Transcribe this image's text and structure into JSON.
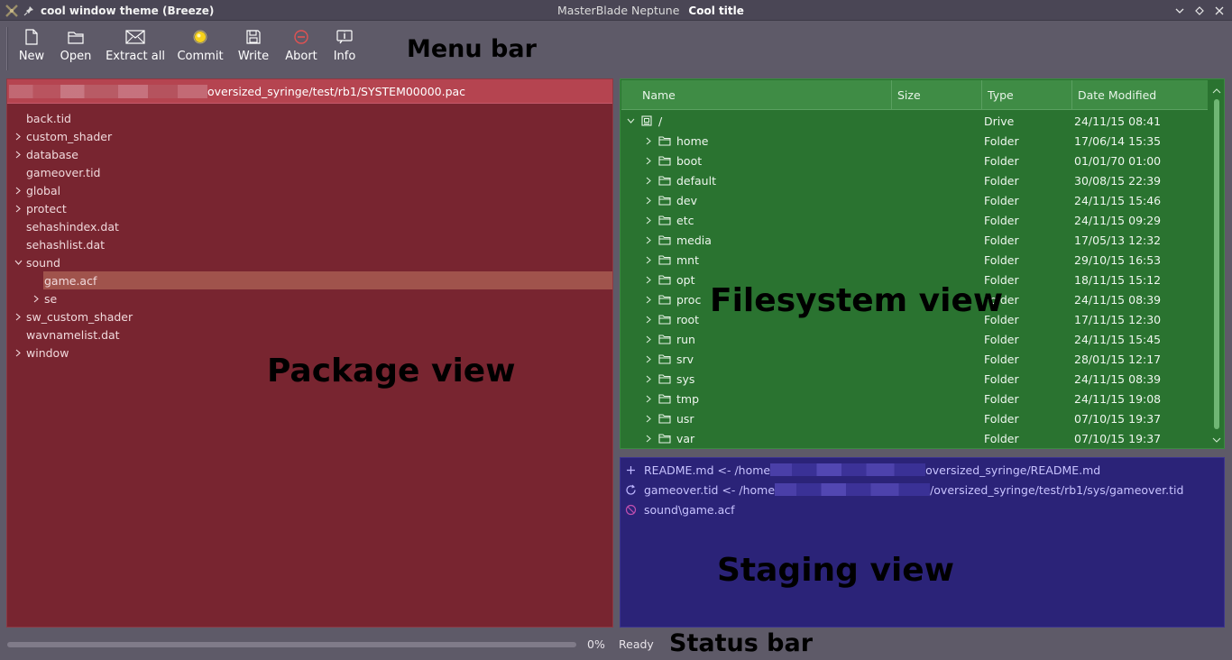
{
  "titlebar": {
    "window_title": "cool window theme (Breeze)",
    "app_name": "MasterBlade Neptune",
    "cool_title": "Cool title"
  },
  "toolbar": {
    "new": "New",
    "open": "Open",
    "extract_all": "Extract all",
    "commit": "Commit",
    "write": "Write",
    "abort": "Abort",
    "info": "Info"
  },
  "annotations": {
    "menu_bar": "Menu bar",
    "package_view": "Package view",
    "filesystem_view": "Filesystem view",
    "staging_view": "Staging view",
    "status_bar": "Status bar"
  },
  "package": {
    "path": "oversized_syringe/test/rb1/SYSTEM00000.pac",
    "items": [
      {
        "label": "back.tid"
      },
      {
        "label": "custom_shader"
      },
      {
        "label": "database"
      },
      {
        "label": "gameover.tid"
      },
      {
        "label": "global"
      },
      {
        "label": "protect"
      },
      {
        "label": "sehashindex.dat"
      },
      {
        "label": "sehashlist.dat"
      },
      {
        "label": "sound"
      },
      {
        "label": "game.acf"
      },
      {
        "label": "se"
      },
      {
        "label": "sw_custom_shader"
      },
      {
        "label": "wavnamelist.dat"
      },
      {
        "label": "window"
      }
    ]
  },
  "filesystem": {
    "columns": {
      "name": "Name",
      "size": "Size",
      "type": "Type",
      "date": "Date Modified"
    },
    "rows": [
      {
        "name": "/",
        "type": "Drive",
        "date": "24/11/15 08:41"
      },
      {
        "name": "home",
        "type": "Folder",
        "date": "17/06/14 15:35"
      },
      {
        "name": "boot",
        "type": "Folder",
        "date": "01/01/70 01:00"
      },
      {
        "name": "default",
        "type": "Folder",
        "date": "30/08/15 22:39"
      },
      {
        "name": "dev",
        "type": "Folder",
        "date": "24/11/15 15:46"
      },
      {
        "name": "etc",
        "type": "Folder",
        "date": "24/11/15 09:29"
      },
      {
        "name": "media",
        "type": "Folder",
        "date": "17/05/13 12:32"
      },
      {
        "name": "mnt",
        "type": "Folder",
        "date": "29/10/15 16:53"
      },
      {
        "name": "opt",
        "type": "Folder",
        "date": "18/11/15 15:12"
      },
      {
        "name": "proc",
        "type": "Folder",
        "date": "24/11/15 08:39"
      },
      {
        "name": "root",
        "type": "Folder",
        "date": "17/11/15 12:30"
      },
      {
        "name": "run",
        "type": "Folder",
        "date": "24/11/15 15:45"
      },
      {
        "name": "srv",
        "type": "Folder",
        "date": "28/01/15 12:17"
      },
      {
        "name": "sys",
        "type": "Folder",
        "date": "24/11/15 08:39"
      },
      {
        "name": "tmp",
        "type": "Folder",
        "date": "24/11/15 19:08"
      },
      {
        "name": "usr",
        "type": "Folder",
        "date": "07/10/15 19:37"
      },
      {
        "name": "var",
        "type": "Folder",
        "date": "07/10/15 19:37"
      }
    ]
  },
  "staging": {
    "items": [
      {
        "prefix": "README.md <- /home",
        "suffix": "oversized_syringe/README.md"
      },
      {
        "prefix": "gameover.tid <- /home",
        "suffix": "/oversized_syringe/test/rb1/sys/gameover.tid"
      },
      {
        "prefix": "sound\\game.acf",
        "suffix": ""
      }
    ]
  },
  "status": {
    "progress_text": "0%",
    "progress_value": 0,
    "message": "Ready"
  }
}
